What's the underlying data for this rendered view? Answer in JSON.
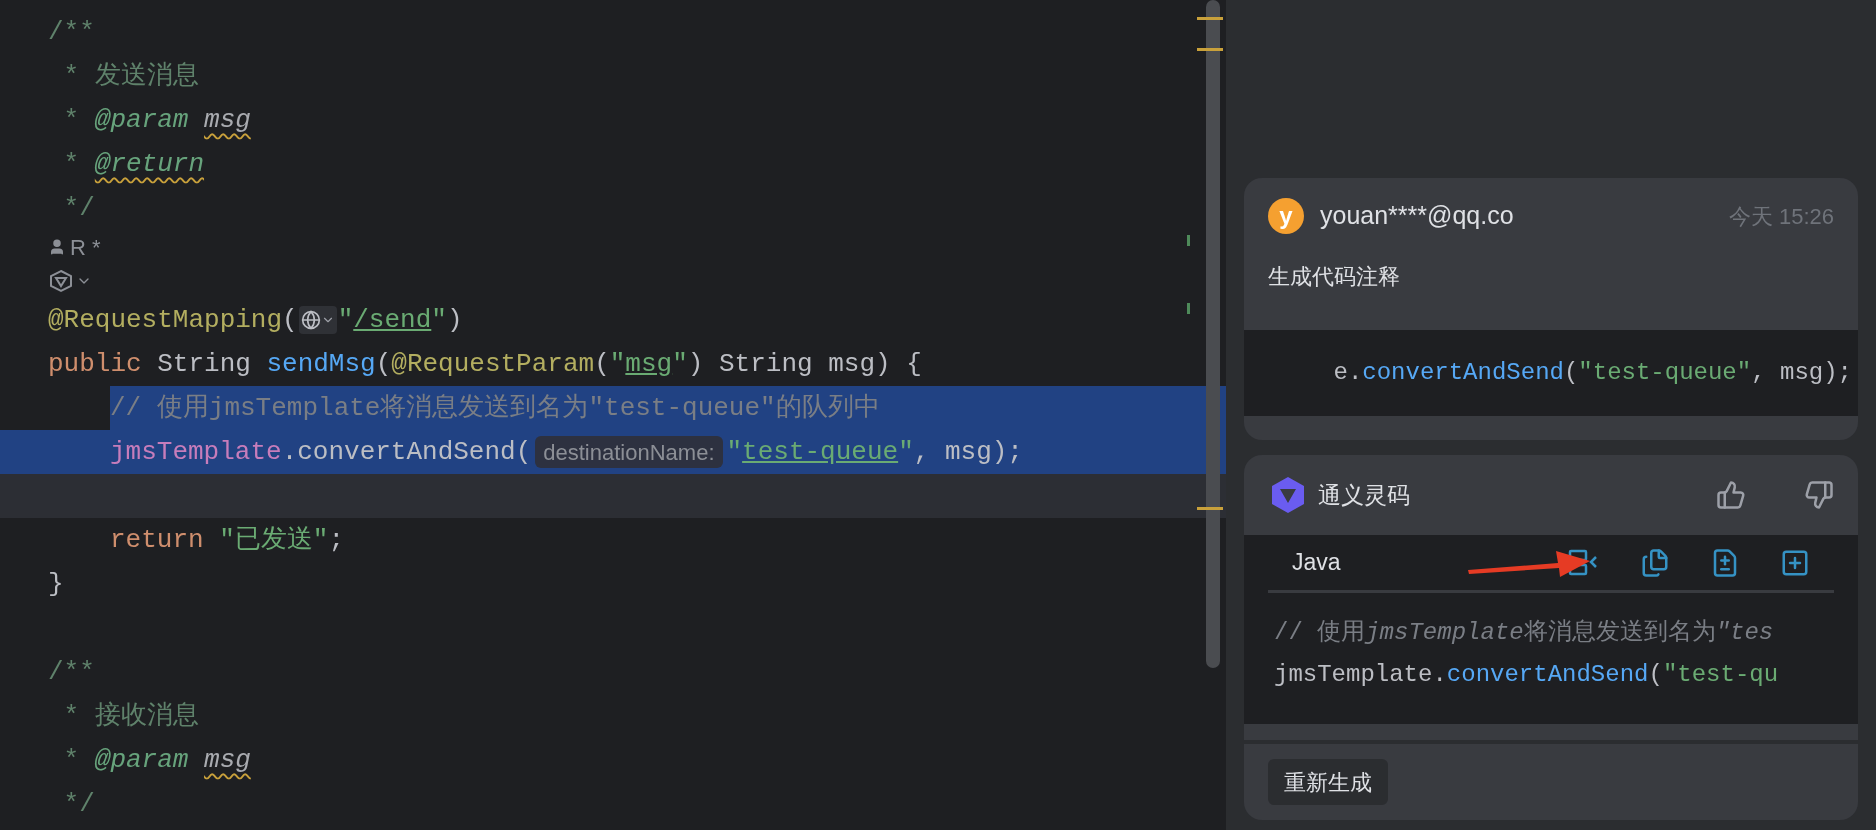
{
  "editor": {
    "lines": [
      {
        "kind": "code",
        "indented": false,
        "selected": false,
        "tokens": [
          {
            "text": "/**",
            "kind": "doc"
          }
        ]
      },
      {
        "kind": "code",
        "indented": false,
        "selected": false,
        "tokens": [
          {
            "text": " * 发送消息",
            "kind": "doc"
          }
        ]
      },
      {
        "kind": "code",
        "indented": false,
        "selected": false,
        "tokens": [
          {
            "text": " * ",
            "kind": "doc"
          },
          {
            "text": "@param ",
            "kind": "doc_tag",
            "warned": false
          },
          {
            "text": "msg",
            "kind": "doc_param",
            "warned": true
          }
        ]
      },
      {
        "kind": "code",
        "indented": false,
        "selected": false,
        "tokens": [
          {
            "text": " * ",
            "kind": "doc"
          },
          {
            "text": "@return",
            "kind": "doc_tag",
            "warned": true
          }
        ]
      },
      {
        "kind": "code",
        "indented": false,
        "selected": false,
        "tokens": [
          {
            "text": " */",
            "kind": "doc"
          }
        ]
      },
      {
        "kind": "author_hint",
        "text": "R *"
      },
      {
        "kind": "ai_hint"
      },
      {
        "kind": "code",
        "indented": false,
        "selected": false,
        "tokens": [
          {
            "text": "@RequestMapping",
            "kind": "annotation"
          },
          {
            "text": "(",
            "kind": "plain"
          },
          {
            "kind": "globe_hint"
          },
          {
            "text": "\"",
            "kind": "string"
          },
          {
            "text": "/send",
            "kind": "string_link"
          },
          {
            "text": "\"",
            "kind": "string"
          },
          {
            "text": ")",
            "kind": "plain"
          }
        ]
      },
      {
        "kind": "code",
        "indented": false,
        "selected": false,
        "tokens": [
          {
            "text": "public",
            "kind": "keyword"
          },
          {
            "text": " String ",
            "kind": "plain"
          },
          {
            "text": "sendMsg",
            "kind": "method"
          },
          {
            "text": "(",
            "kind": "plain"
          },
          {
            "text": "@RequestParam",
            "kind": "annotation"
          },
          {
            "text": "(",
            "kind": "plain"
          },
          {
            "text": "\"",
            "kind": "string"
          },
          {
            "text": "msg",
            "kind": "string_link"
          },
          {
            "text": "\"",
            "kind": "string"
          },
          {
            "text": ") String msg) {",
            "kind": "plain"
          }
        ]
      },
      {
        "kind": "code",
        "indented": true,
        "selected": true,
        "tokens": [
          {
            "text": "// 使用jmsTemplate将消息发送到名为\"test-queue\"的队列中",
            "kind": "comment"
          }
        ]
      },
      {
        "kind": "code",
        "indented": true,
        "selected": true,
        "tokens": [
          {
            "text": "jmsTemplate",
            "kind": "field"
          },
          {
            "text": ".convertAndSend(",
            "kind": "plain"
          },
          {
            "text": "destinationName:",
            "kind": "hint"
          },
          {
            "text": "\"",
            "kind": "string"
          },
          {
            "text": "test-queue",
            "kind": "string_link"
          },
          {
            "text": "\"",
            "kind": "string"
          },
          {
            "text": ", msg);",
            "kind": "plain"
          }
        ]
      },
      {
        "kind": "current_line",
        "selected": false
      },
      {
        "kind": "code",
        "indented": true,
        "selected": false,
        "tokens": [
          {
            "text": "return ",
            "kind": "keyword"
          },
          {
            "text": "\"已发送\"",
            "kind": "string"
          },
          {
            "text": ";",
            "kind": "plain"
          }
        ]
      },
      {
        "kind": "code",
        "indented": false,
        "selected": false,
        "tokens": [
          {
            "text": "}",
            "kind": "plain"
          }
        ]
      },
      {
        "kind": "code",
        "selected": false
      },
      {
        "kind": "code",
        "indented": false,
        "selected": false,
        "tokens": [
          {
            "text": "/**",
            "kind": "doc"
          }
        ]
      },
      {
        "kind": "code",
        "indented": false,
        "selected": false,
        "tokens": [
          {
            "text": " * 接收消息",
            "kind": "doc"
          }
        ]
      },
      {
        "kind": "code",
        "indented": false,
        "selected": false,
        "tokens": [
          {
            "text": " * ",
            "kind": "doc"
          },
          {
            "text": "@param ",
            "kind": "doc_tag",
            "warned": false
          },
          {
            "text": "msg",
            "kind": "doc_param",
            "warned": true
          }
        ]
      },
      {
        "kind": "code",
        "indented": false,
        "selected": false,
        "tokens": [
          {
            "text": " */",
            "kind": "doc"
          }
        ]
      }
    ]
  },
  "chat": {
    "user_message": {
      "avatar_letter": "y",
      "user": "youan****@qq.co",
      "time": "今天 15:26",
      "text": "生成代码注释",
      "code": [
        [
          {
            "text": "e.",
            "kind": "plain"
          },
          {
            "text": "convertAndSend",
            "kind": "method"
          },
          {
            "text": "(",
            "kind": "plain"
          },
          {
            "text": "\"test-queue\"",
            "kind": "string"
          },
          {
            "text": ", msg);",
            "kind": "plain"
          }
        ]
      ]
    },
    "reply": {
      "assistant": "通义灵码",
      "language": "Java",
      "code": [
        [
          {
            "text": "// 使用",
            "kind": "comment",
            "italic": false
          },
          {
            "text": "jmsTemplate",
            "kind": "comment",
            "italic": true
          },
          {
            "text": "将消息发送到名为",
            "kind": "comment",
            "italic": false
          },
          {
            "text": "\"tes",
            "kind": "comment",
            "italic": true
          }
        ],
        [
          {
            "text": "jmsTemplate.",
            "kind": "plain"
          },
          {
            "text": "convertAndSend",
            "kind": "method"
          },
          {
            "text": "(",
            "kind": "plain"
          },
          {
            "text": "\"test-qu",
            "kind": "string"
          }
        ]
      ]
    },
    "regenerate_button": "重新生成"
  }
}
